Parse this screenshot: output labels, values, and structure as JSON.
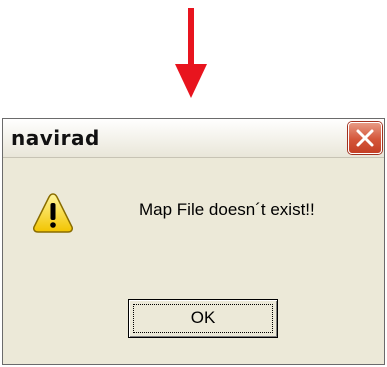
{
  "dialog": {
    "title": "navirad",
    "message": "Map File doesn´t exist!!",
    "ok_label": "OK",
    "close_icon": "close-icon",
    "warning_icon": "warning-icon"
  },
  "annotation": {
    "arrow_icon": "down-arrow-icon",
    "arrow_color": "#e8141e"
  },
  "colors": {
    "dialog_background": "#ece9d8",
    "close_button_red": "#d4563a"
  }
}
